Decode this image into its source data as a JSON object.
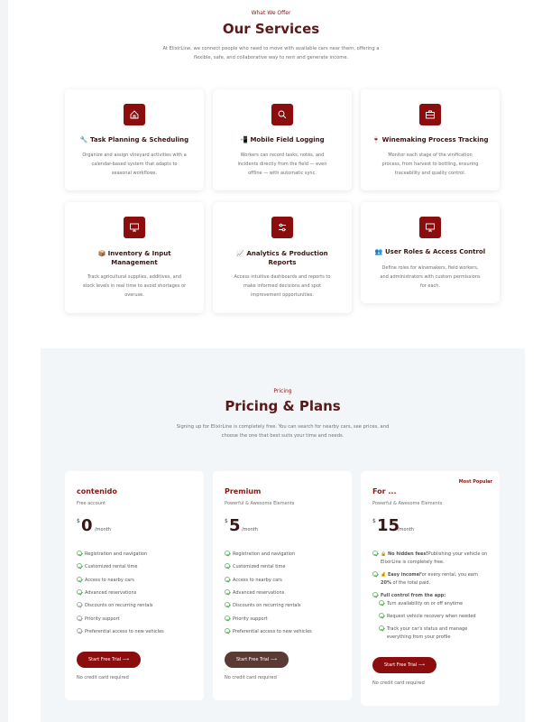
{
  "services": {
    "eyebrow": "What We Offer",
    "title": "Our Services",
    "desc_line1": "At ElixirLine, we connect people who need to move with available cars near them, offering a",
    "desc_line2": "flexible, safe, and collaborative way to rent and generate income.",
    "cards": [
      {
        "icon": "home-icon",
        "title": "🔧 Task Planning & Scheduling",
        "desc": [
          "Organize and assign vineyard activities with a",
          "calendar-based system that adapts to",
          "seasonal workflows."
        ]
      },
      {
        "icon": "search-icon",
        "title": "📲 Mobile Field Logging",
        "desc": [
          "Workers can record tasks, notes, and",
          "incidents directly from the field — even",
          "offline — with automatic sync."
        ]
      },
      {
        "icon": "briefcase-icon",
        "title": "🍷 Winemaking Process Tracking",
        "desc": [
          "Monitor each stage of the vinification",
          "process, from harvest to bottling, ensuring",
          "traceability and quality control."
        ]
      },
      {
        "icon": "monitor-icon",
        "title_l1": "📦 Inventory & Input",
        "title_l2": "Management",
        "desc": [
          "Track agricultural supplies, additives, and",
          "stock levels in real time to avoid shortages or",
          "overuse."
        ]
      },
      {
        "icon": "sliders-icon",
        "title_l1": "📈 Analytics & Production",
        "title_l2": "Reports",
        "desc": [
          "Access intuitive dashboards and reports to",
          "make informed decisions and spot",
          "improvement opportunities."
        ]
      },
      {
        "icon": "monitor-icon",
        "title": "👥 User Roles & Access Control",
        "desc": [
          "Define roles for winemakers, field workers,",
          "and administrators with custom permissions",
          "for each."
        ]
      }
    ]
  },
  "pricing": {
    "eyebrow": "Pricing",
    "title": "Pricing & Plans",
    "desc_line1": "Signing up for ElixirLine is completely free. You can search for nearby cars, see prices, and",
    "desc_line2": "choose the one that best suits your time and needs.",
    "plans": [
      {
        "name": "contenido",
        "sub": "Free account",
        "currency": "$",
        "amount": "0",
        "per": "/month",
        "features": [
          "Registration and navigation",
          "Customized rental time",
          "Access to nearby cars",
          "Advanced reservations",
          "Discounts on recurring rentals",
          "Priority support",
          "Preferential access to new vehicles"
        ],
        "cta": "Start Free Trial ⟶",
        "note": "No credit card required"
      },
      {
        "name": "Premium",
        "sub": "Powerful & Awesome Elements",
        "currency": "$",
        "amount": "5",
        "per": "/month",
        "features": [
          "Registration and navigation",
          "Customized rental time",
          "Access to nearby cars",
          "Advanced reservations",
          "Discounts on recurring rentals",
          "Priority support",
          "Preferential access to new vehicles"
        ],
        "cta": "Start Free Trial ⟶",
        "note": "No credit card required"
      },
      {
        "name": "For ...",
        "sub": "Powerful & Awesome Elements",
        "currency": "$",
        "amount": "15",
        "per": "/month",
        "badge": "Most Popular",
        "f1_bold": "🔒 No hidden fees!",
        "f1_rest": "Publishing your vehicle on",
        "f1_l2": "ElixirLine is completely free.",
        "f2_bold": "💰 Easy income",
        "f2_rest": "For every rental, you earn",
        "f2_l2_bold": "20%",
        "f2_l2_rest": " of the total paid.",
        "f3_bold": "Full control from the app:",
        "sub_features": [
          "Turn availability on or off anytime",
          "Request vehicle recovery when needed",
          "Track your car's status and manage"
        ],
        "sub_l2": "everything from your profile",
        "cta": "Start Free Trial ⟶",
        "note": "No credit card required"
      }
    ]
  },
  "colors": {
    "accent": "#8b0d0d",
    "title": "#5a1a1a",
    "pricing_bg": "#f3f6f9",
    "check": "#5aa85a"
  }
}
